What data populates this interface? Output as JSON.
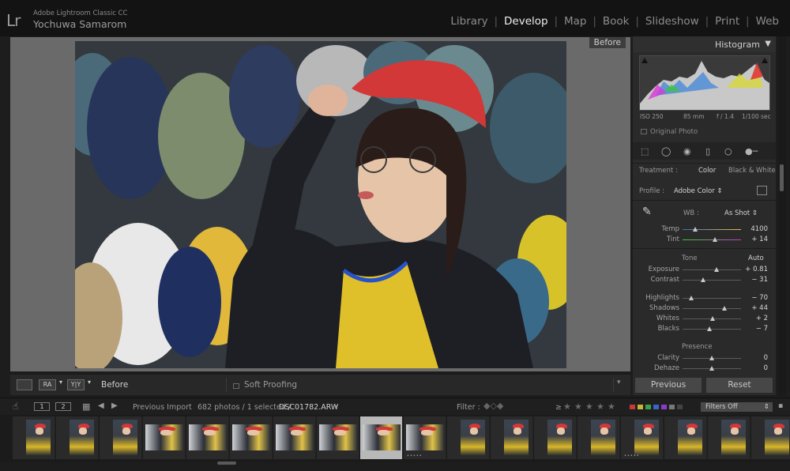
{
  "app": {
    "logo": "Lr",
    "name": "Adobe Lightroom Classic CC",
    "user": "Yochuwa Samarom"
  },
  "modules": [
    {
      "label": "Library",
      "active": false
    },
    {
      "label": "Develop",
      "active": true
    },
    {
      "label": "Map",
      "active": false
    },
    {
      "label": "Book",
      "active": false
    },
    {
      "label": "Slideshow",
      "active": false
    },
    {
      "label": "Print",
      "active": false
    },
    {
      "label": "Web",
      "active": false
    }
  ],
  "view": {
    "before_tag": "Before"
  },
  "toolbar": {
    "view_label": "Before",
    "soft_proofing": "Soft Proofing",
    "yy_label": "Y|Y"
  },
  "histogram": {
    "title": "Histogram",
    "iso": "ISO 250",
    "focal": "85 mm",
    "aperture": "f / 1.4",
    "shutter": "1/100 sec",
    "original_photo": "Original Photo"
  },
  "basic": {
    "treatment_label": "Treatment :",
    "treatment_color": "Color",
    "treatment_bw": "Black & White",
    "profile_label": "Profile :",
    "profile_value": "Adobe Color",
    "wb_label": "WB :",
    "wb_value": "As Shot",
    "tone_label": "Tone",
    "auto_label": "Auto",
    "presence_label": "Presence"
  },
  "sliders": [
    {
      "label": "Temp",
      "value": "4100",
      "pos": 0.22
    },
    {
      "label": "Tint",
      "value": "+ 14",
      "pos": 0.55
    },
    {
      "label": "Exposure",
      "value": "+ 0.81",
      "pos": 0.58
    },
    {
      "label": "Contrast",
      "value": "− 31",
      "pos": 0.35
    },
    {
      "label": "Highlights",
      "value": "− 70",
      "pos": 0.15
    },
    {
      "label": "Shadows",
      "value": "+ 44",
      "pos": 0.72
    },
    {
      "label": "Whites",
      "value": "+ 2",
      "pos": 0.51
    },
    {
      "label": "Blacks",
      "value": "− 7",
      "pos": 0.46
    },
    {
      "label": "Clarity",
      "value": "0",
      "pos": 0.5
    },
    {
      "label": "Dehaze",
      "value": "0",
      "pos": 0.5
    }
  ],
  "panel_buttons": {
    "previous": "Previous",
    "reset": "Reset"
  },
  "filmbar": {
    "page1": "1",
    "page2": "2",
    "source": "Previous Import",
    "count": "682 photos / 1 selected /",
    "filename": "DSC01782.ARW",
    "filter_label": "Filter :",
    "rating_op": "≥",
    "filters_off": "Filters Off"
  },
  "colors": {
    "label_red": "#c83a3a",
    "label_yellow": "#c8b43a",
    "label_green": "#3aa04a",
    "label_blue": "#3a64c8",
    "label_purple": "#8a3ac8",
    "hat_red": "#d23838",
    "top_yellow": "#e0c02a"
  }
}
